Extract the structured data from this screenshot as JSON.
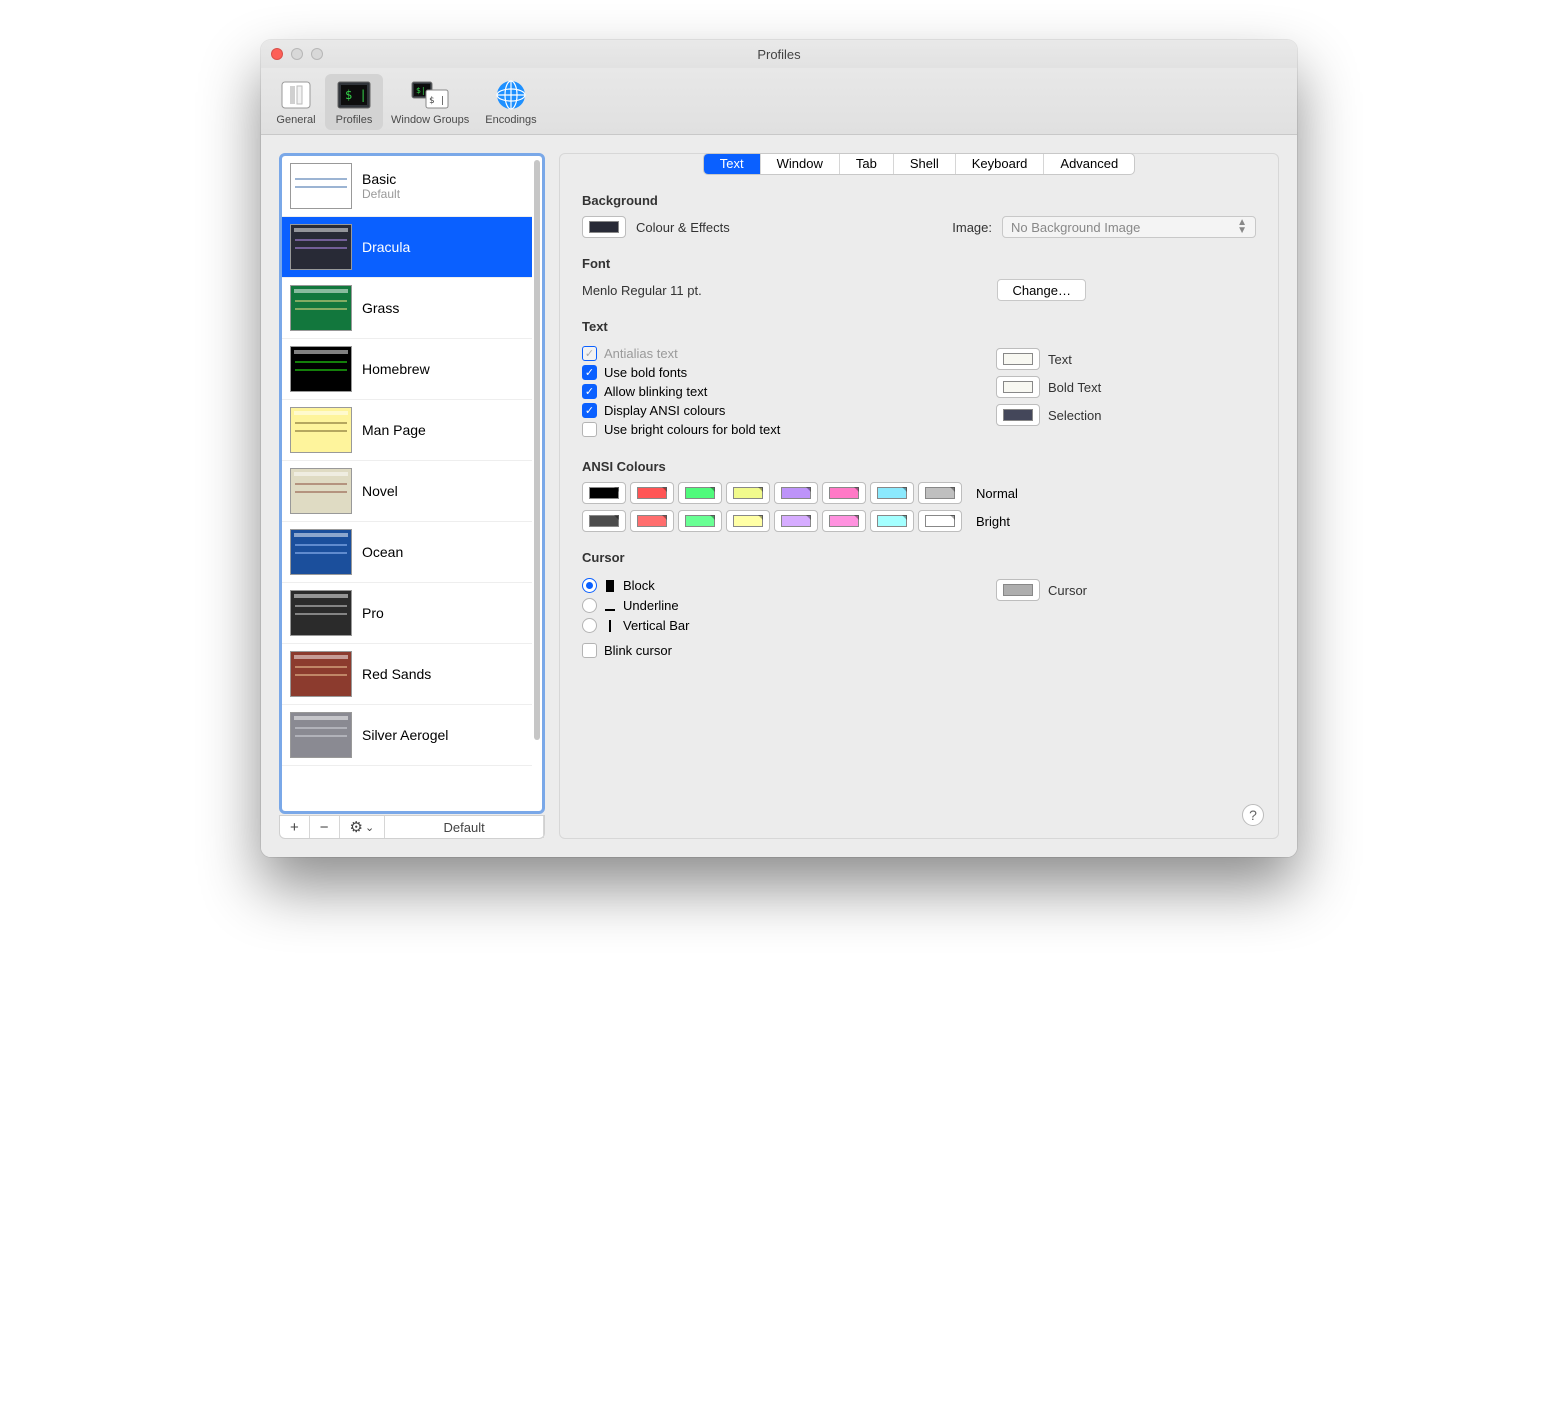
{
  "window": {
    "title": "Profiles"
  },
  "toolbar": {
    "items": [
      {
        "label": "General"
      },
      {
        "label": "Profiles"
      },
      {
        "label": "Window Groups"
      },
      {
        "label": "Encodings"
      }
    ],
    "activeIndex": 1
  },
  "sidebar": {
    "profiles": [
      {
        "name": "Basic",
        "sub": "Default",
        "bg": "#ffffff",
        "fg": "#3a6aa8"
      },
      {
        "name": "Dracula",
        "sub": "",
        "bg": "#282a36",
        "fg": "#bd93f9",
        "selected": true
      },
      {
        "name": "Grass",
        "sub": "",
        "bg": "#12773d",
        "fg": "#f4e28a"
      },
      {
        "name": "Homebrew",
        "sub": "",
        "bg": "#000000",
        "fg": "#28fe14"
      },
      {
        "name": "Man Page",
        "sub": "",
        "bg": "#fef49c",
        "fg": "#6b5a22"
      },
      {
        "name": "Novel",
        "sub": "",
        "bg": "#dfdbc3",
        "fg": "#8a4b3a"
      },
      {
        "name": "Ocean",
        "sub": "",
        "bg": "#1b4f9c",
        "fg": "#a5c8ff"
      },
      {
        "name": "Pro",
        "sub": "",
        "bg": "#2b2b2b",
        "fg": "#dddddd"
      },
      {
        "name": "Red Sands",
        "sub": "",
        "bg": "#8c3b2e",
        "fg": "#f3d2a0"
      },
      {
        "name": "Silver Aerogel",
        "sub": "",
        "bg": "#8a8a92",
        "fg": "#d7d9e0"
      }
    ],
    "actions": {
      "add": "+",
      "remove": "−",
      "gear": "⚙︎",
      "chevron": "⌄",
      "default": "Default"
    }
  },
  "tabs": {
    "items": [
      "Text",
      "Window",
      "Tab",
      "Shell",
      "Keyboard",
      "Advanced"
    ],
    "activeIndex": 0
  },
  "background": {
    "heading": "Background",
    "colourEffects": "Colour & Effects",
    "swatchColor": "#282a36",
    "imageLabel": "Image:",
    "imagePopup": "No Background Image"
  },
  "font": {
    "heading": "Font",
    "description": "Menlo Regular 11 pt.",
    "changeButton": "Change…"
  },
  "text": {
    "heading": "Text",
    "options": [
      {
        "label": "Antialias text",
        "checked": true,
        "disabled": true
      },
      {
        "label": "Use bold fonts",
        "checked": true
      },
      {
        "label": "Allow blinking text",
        "checked": true
      },
      {
        "label": "Display ANSI colours",
        "checked": true
      },
      {
        "label": "Use bright colours for bold text",
        "checked": false
      }
    ],
    "samples": [
      {
        "label": "Text",
        "color": "#f8f8f2"
      },
      {
        "label": "Bold Text",
        "color": "#f8f8f2"
      },
      {
        "label": "Selection",
        "color": "#44475a"
      }
    ]
  },
  "ansi": {
    "heading": "ANSI Colours",
    "normalLabel": "Normal",
    "brightLabel": "Bright",
    "normal": [
      "#000000",
      "#ff5555",
      "#50fa7b",
      "#f1fa8c",
      "#bd93f9",
      "#ff79c6",
      "#8be9fd",
      "#bfbfbf"
    ],
    "bright": [
      "#4d4d4d",
      "#ff6e6e",
      "#69ff94",
      "#ffffa5",
      "#d6acff",
      "#ff92df",
      "#a4ffff",
      "#ffffff"
    ]
  },
  "cursor": {
    "heading": "Cursor",
    "options": [
      {
        "label": "Block",
        "checked": true
      },
      {
        "label": "Underline",
        "checked": false
      },
      {
        "label": "Vertical Bar",
        "checked": false
      }
    ],
    "blink": {
      "label": "Blink cursor",
      "checked": false
    },
    "swatchLabel": "Cursor",
    "swatchColor": "#aeaeae"
  },
  "help": "?"
}
